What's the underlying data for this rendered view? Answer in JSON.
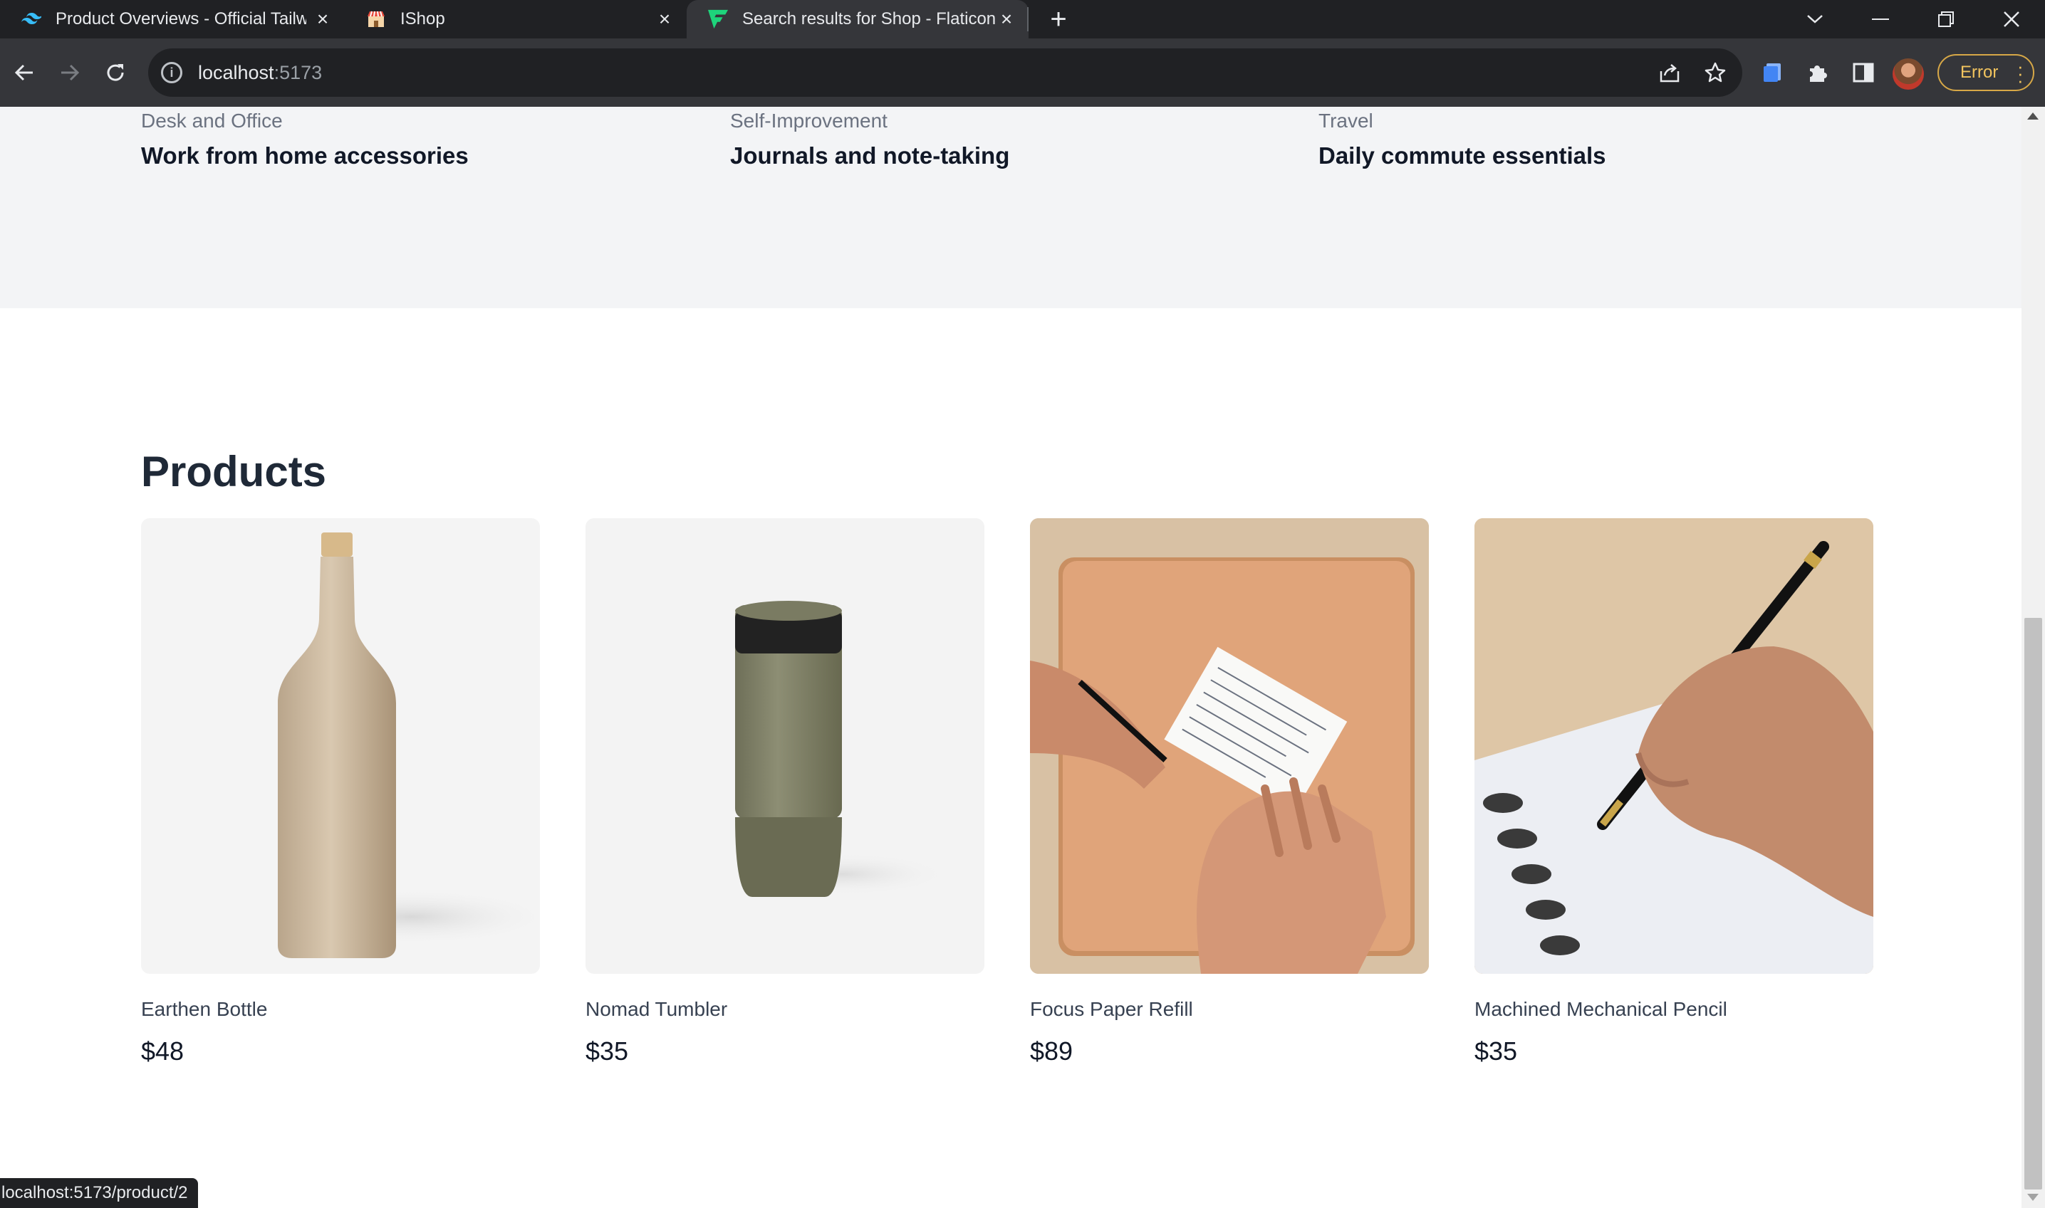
{
  "browser": {
    "tabs": [
      {
        "title": "Product Overviews - Official Tailw",
        "favicon": "tailwind-icon",
        "active": false
      },
      {
        "title": "IShop",
        "favicon": "shop-icon",
        "active": false
      },
      {
        "title": "Search results for Shop - Flaticon",
        "favicon": "flaticon-icon",
        "active": true
      }
    ],
    "url_host": "localhost",
    "url_port": ":5173",
    "profile_status": "Error",
    "status_url": "localhost:5173/product/2"
  },
  "categories": [
    {
      "sub": "Desk and Office",
      "title": "Work from home accessories"
    },
    {
      "sub": "Self-Improvement",
      "title": "Journals and note-taking"
    },
    {
      "sub": "Travel",
      "title": "Daily commute essentials"
    }
  ],
  "products_section": {
    "title": "Products",
    "items": [
      {
        "name": "Earthen Bottle",
        "price": "$48",
        "image": "earthen-bottle-image"
      },
      {
        "name": "Nomad Tumbler",
        "price": "$35",
        "image": "nomad-tumbler-image"
      },
      {
        "name": "Focus Paper Refill",
        "price": "$89",
        "image": "focus-paper-refill-image"
      },
      {
        "name": "Machined Mechanical Pencil",
        "price": "$35",
        "image": "mechanical-pencil-image"
      }
    ]
  },
  "colors": {
    "chrome_dark": "#202124",
    "chrome_toolbar": "#35363a",
    "page_gray": "#f3f4f6",
    "heading": "#1f2937",
    "error_accent": "#f2c45e"
  }
}
